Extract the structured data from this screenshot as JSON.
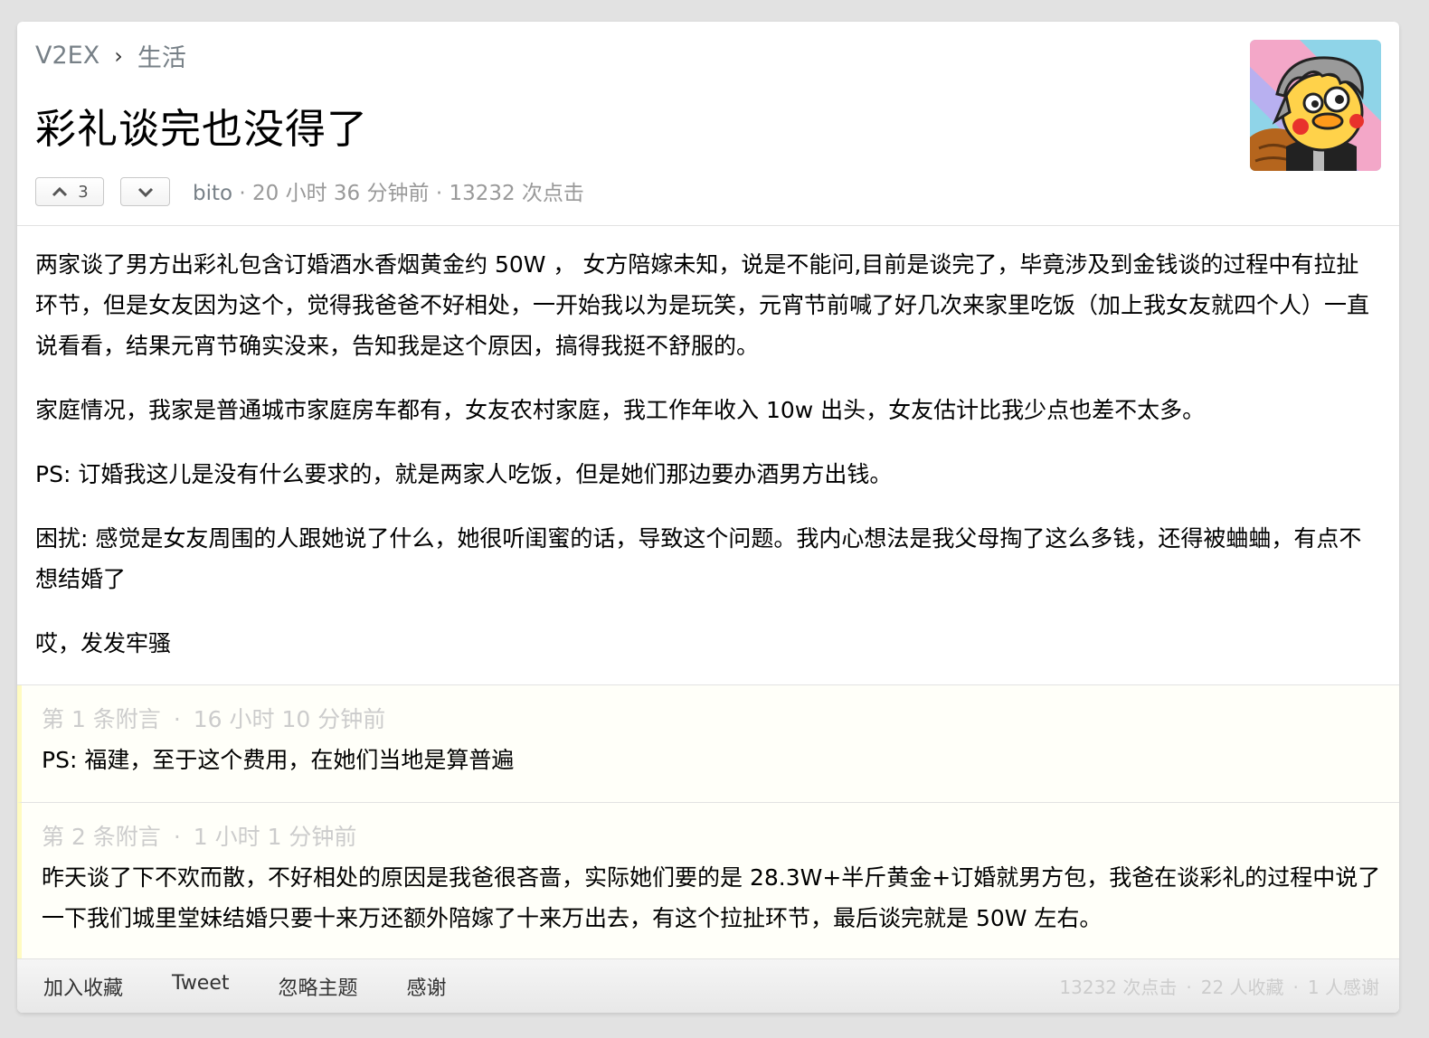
{
  "breadcrumb": {
    "site": "V2EX",
    "separator": "›",
    "node": "生活"
  },
  "topic": {
    "title": "彩礼谈完也没得了",
    "upvotes": "3",
    "author": "bito",
    "time": "20 小时 36 分钟前",
    "clicks": "13232 次点击",
    "meta_sep": "·"
  },
  "content": {
    "paragraphs": [
      "两家谈了男方出彩礼包含订婚酒水香烟黄金约 50W ， 女方陪嫁未知，说是不能问,目前是谈完了，毕竟涉及到金钱谈的过程中有拉扯环节，但是女友因为这个，觉得我爸爸不好相处，一开始我以为是玩笑，元宵节前喊了好几次来家里吃饭（加上我女友就四个人）一直说看看，结果元宵节确实没来，告知我是这个原因，搞得我挺不舒服的。",
      "家庭情况，我家是普通城市家庭房车都有，女友农村家庭，我工作年收入 10w 出头，女友估计比我少点也差不太多。",
      "PS: 订婚我这儿是没有什么要求的，就是两家人吃饭，但是她们那边要办酒男方出钱。",
      "困扰: 感觉是女友周围的人跟她说了什么，她很听闺蜜的话，导致这个问题。我内心想法是我父母掏了这么多钱，还得被蛐蛐，有点不想结婚了",
      "哎，发发牢骚"
    ]
  },
  "appends": [
    {
      "label": "第 1 条附言",
      "sep": "·",
      "time": "16 小时 10 分钟前",
      "text": "PS: 福建，至于这个费用，在她们当地是算普遍"
    },
    {
      "label": "第 2 条附言",
      "sep": "·",
      "time": "1 小时 1 分钟前",
      "text": "昨天谈了下不欢而散，不好相处的原因是我爸很吝啬，实际她们要的是 28.3W+半斤黄金+订婚就男方包，我爸在谈彩礼的过程中说了一下我们城里堂妹结婚只要十来万还额外陪嫁了十来万出去，有这个拉扯环节，最后谈完就是 50W 左右。"
    }
  ],
  "footer": {
    "links": [
      "加入收藏",
      "Tweet",
      "忽略主题",
      "感谢"
    ],
    "stats": {
      "clicks": "13232 次点击",
      "favorites": "22 人收藏",
      "thanks": "1 人感谢",
      "sep": "·"
    }
  },
  "colors": {
    "link_gray": "#778087",
    "fade": "#cccccc",
    "append_bg": "#fffff9",
    "append_border": "#fffbc1"
  }
}
